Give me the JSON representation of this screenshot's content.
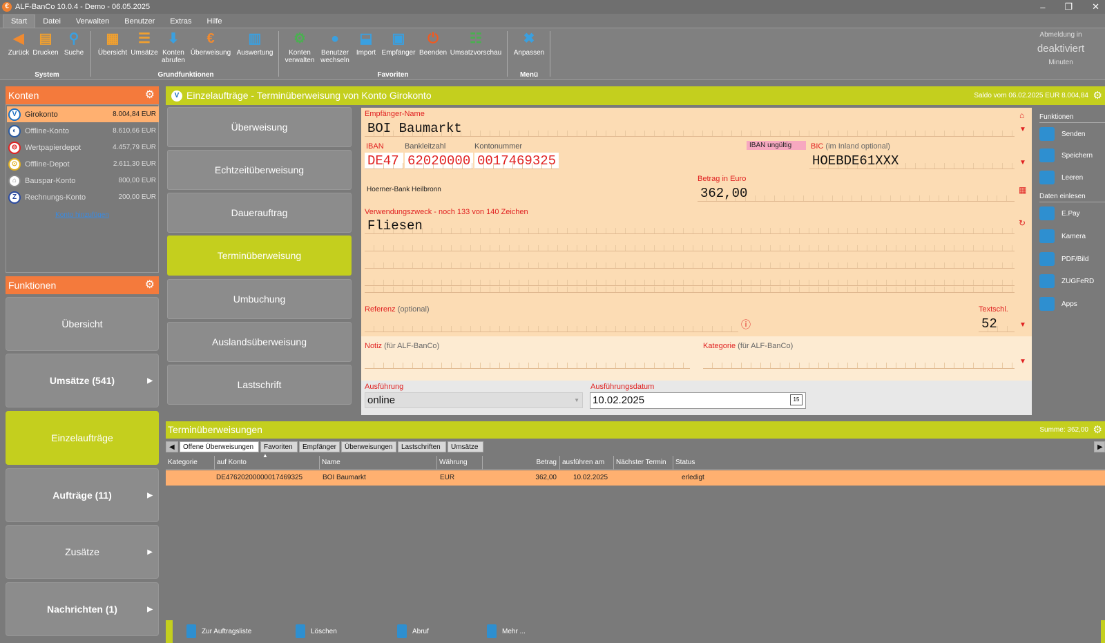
{
  "window": {
    "title": "ALF-BanCo 10.0.4 - Demo  -  06.05.2025",
    "controls": [
      "–",
      "❐",
      "✕"
    ]
  },
  "menu": [
    "Start",
    "Datei",
    "Verwalten",
    "Benutzer",
    "Extras",
    "Hilfe"
  ],
  "ribbon": {
    "system": {
      "label": "System",
      "buttons": [
        "Zurück",
        "Drucken",
        "Suche"
      ]
    },
    "grund": {
      "label": "Grundfunktionen",
      "buttons": [
        "Übersicht",
        "Umsätze",
        "Konten abrufen",
        "Überweisung",
        "Auswertung"
      ]
    },
    "fav": {
      "label": "Favoriten",
      "buttons": [
        "Konten verwalten",
        "Benutzer wechseln",
        "Import",
        "Empfänger",
        "Beenden",
        "Umsatzvorschau"
      ]
    },
    "menu": {
      "label": "Menü",
      "buttons": [
        "Anpassen"
      ]
    },
    "logoff": {
      "line1": "Abmeldung in",
      "line2": "deaktiviert",
      "line3": "Minuten"
    }
  },
  "konten": {
    "title": "Konten",
    "items": [
      {
        "name": "Girokonto",
        "balance": "8.004,84 EUR",
        "color": "#1a6fc0"
      },
      {
        "name": "Offline-Konto",
        "balance": "8.610,66 EUR",
        "color": "#2a5aa0"
      },
      {
        "name": "Wertpapierdepot",
        "balance": "4.457,79 EUR",
        "color": "#e02020"
      },
      {
        "name": "Offline-Depot",
        "balance": "2.611,30 EUR",
        "color": "#e0b020"
      },
      {
        "name": "Bauspar-Konto",
        "balance": "800,00 EUR",
        "color": "#888888"
      },
      {
        "name": "Rechnungs-Konto",
        "balance": "200,00 EUR",
        "color": "#2a4aa0"
      }
    ],
    "add_link": "Konto hinzufügen"
  },
  "funktionen": {
    "title": "Funktionen",
    "items": [
      "Übersicht",
      "Umsätze (541)",
      "Einzelaufträge",
      "Aufträge (11)",
      "Zusätze",
      "Nachrichten (1)"
    ]
  },
  "main": {
    "title": "Einzelaufträge - Terminüberweisung von Konto Girokonto",
    "saldo": "Saldo vom 06.02.2025 EUR 8.004,84"
  },
  "types": [
    "Überweisung",
    "Echtzeitüberweisung",
    "Dauerauftrag",
    "Terminüberweisung",
    "Umbuchung",
    "Auslandsüberweisung",
    "Lastschrift"
  ],
  "form": {
    "empf_label": "Empfänger-Name",
    "empf_value": "BOI Baumarkt",
    "iban_label": "IBAN",
    "blz_label": "Bankleitzahl",
    "kto_label": "Kontonummer",
    "iban_part1": "DE47",
    "iban_part2": "62020000",
    "iban_part3": "0017469325",
    "iban_invalid": "IBAN ungültig",
    "bic_label": "BIC",
    "bic_hint": "(im Inland optional)",
    "bic_value": "HOEBDE61XXX",
    "bank_name": "Hoerner-Bank Heilbronn",
    "betrag_label": "Betrag in Euro",
    "betrag_value": "362,00",
    "zweck_label": "Verwendungszweck - noch 133 von 140 Zeichen",
    "zweck_value": "Fliesen",
    "ref_label": "Referenz",
    "ref_hint": "(optional)",
    "textschl_label": "Textschl.",
    "textschl_value": "52",
    "notiz_label": "Notiz",
    "notiz_hint": "(für ALF-BanCo)",
    "kat_label": "Kategorie",
    "kat_hint": "(für ALF-BanCo)",
    "ausf_label": "Ausführung",
    "ausf_value": "online",
    "datum_label": "Ausführungsdatum",
    "datum_value": "10.02.2025"
  },
  "rightside": {
    "h1": "Funktionen",
    "f": [
      "Senden",
      "Speichern",
      "Leeren"
    ],
    "h2": "Daten einlesen",
    "d": [
      "E.Pay",
      "Kamera",
      "PDF/Bild",
      "ZUGFeRD",
      "Apps"
    ]
  },
  "list": {
    "title": "Terminüberweisungen",
    "summe": "Summe: 362,00",
    "tabs": [
      "Offene Überweisungen",
      "Favoriten",
      "Empfänger",
      "Überweisungen",
      "Lastschriften",
      "Umsätze"
    ],
    "columns": [
      "Kategorie",
      "auf Konto",
      "Name",
      "Währung",
      "Betrag",
      "ausführen am",
      "Nächster Termin",
      "Status"
    ],
    "rows": [
      {
        "kategorie": "",
        "konto": "DE47620200000017469325",
        "name": "BOI Baumarkt",
        "waehrung": "EUR",
        "betrag": "362,00",
        "datum": "10.02.2025",
        "naechster": "",
        "status": "erledigt"
      }
    ]
  },
  "bottom": [
    "Zur Auftragsliste",
    "Löschen",
    "Abruf",
    "Mehr ..."
  ]
}
